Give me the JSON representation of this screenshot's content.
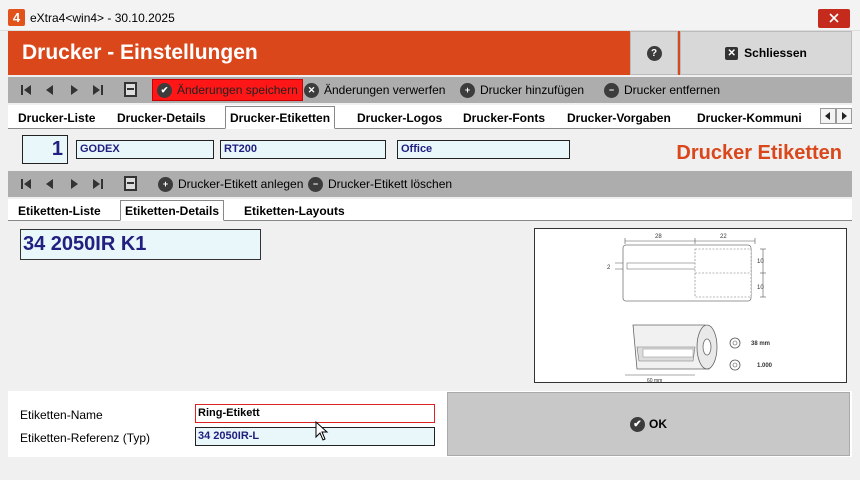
{
  "window": {
    "title": "eXtra4<win4>  -  30.10.2025",
    "logo_text": "4"
  },
  "header": {
    "title": "Drucker - Einstellungen",
    "help_label": "?",
    "close_label": "Schliessen"
  },
  "toolbar1": {
    "save_changes": "Änderungen speichern",
    "discard_changes": "Änderungen verwerfen",
    "add_printer": "Drucker hinzufügen",
    "remove_printer": "Drucker entfernen"
  },
  "main_tabs": [
    {
      "label": "Drucker-Liste",
      "active": false
    },
    {
      "label": "Drucker-Details",
      "active": false
    },
    {
      "label": "Drucker-Etiketten",
      "active": true
    },
    {
      "label": "Drucker-Logos",
      "active": false
    },
    {
      "label": "Drucker-Fonts",
      "active": false
    },
    {
      "label": "Drucker-Vorgaben",
      "active": false
    },
    {
      "label": "Drucker-Kommuni",
      "active": false
    }
  ],
  "printer": {
    "number": "1",
    "make": "GODEX",
    "model": "RT200",
    "location": "Office"
  },
  "section_title": "Drucker Etiketten",
  "toolbar2": {
    "add_label": "Drucker-Etikett anlegen",
    "delete_label": "Drucker-Etikett löschen"
  },
  "sub_tabs": [
    {
      "label": "Etiketten-Liste",
      "active": false
    },
    {
      "label": "Etiketten-Details",
      "active": true
    },
    {
      "label": "Etiketten-Layouts",
      "active": false
    }
  ],
  "label_code": "34 2050IR K1",
  "label_image": {
    "dim_top_left": "28",
    "dim_top_right": "22",
    "dim_side": "2",
    "dim_right_top": "10",
    "dim_right_bottom": "10",
    "core_size": "38 mm",
    "roll_count": "1.000",
    "roll_width": "60 mm"
  },
  "form": {
    "name_label": "Etiketten-Name",
    "name_value": "Ring-Etikett",
    "ref_label": "Etiketten-Referenz (Typ)",
    "ref_value": "34 2050IR-L",
    "ok_label": "OK"
  }
}
